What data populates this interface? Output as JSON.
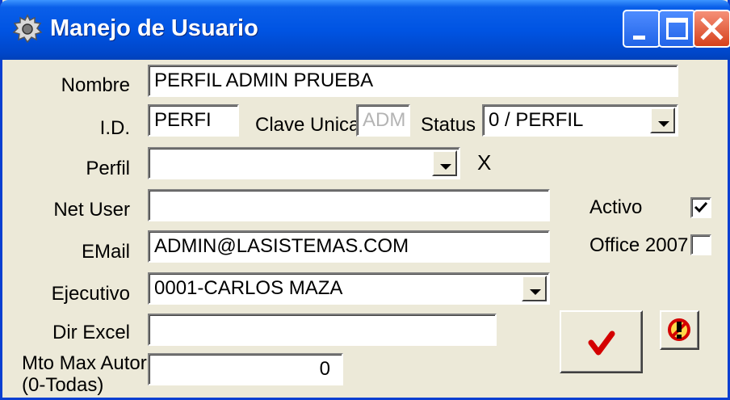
{
  "window": {
    "title": "Manejo de Usuario",
    "icons": [
      "gear-icon",
      "minimize-icon",
      "maximize-icon",
      "close-icon"
    ]
  },
  "form": {
    "nombre": {
      "label": "Nombre",
      "value": "PERFIL ADMIN PRUEBA"
    },
    "id": {
      "label": "I.D.",
      "value": "PERFI"
    },
    "clave_unica": {
      "label": "Clave Unica",
      "value": "ADM"
    },
    "status": {
      "label": "Status",
      "value": "0 / PERFIL"
    },
    "perfil": {
      "label": "Perfil",
      "value": "",
      "clear_label": "X"
    },
    "net_user": {
      "label": "Net User",
      "value": ""
    },
    "email": {
      "label": "EMail",
      "value": "ADMIN@LASISTEMAS.COM"
    },
    "ejecutivo": {
      "label": "Ejecutivo",
      "value": "0001-CARLOS MAZA"
    },
    "dir_excel": {
      "label": "Dir Excel",
      "value": ""
    },
    "mto_max_autor": {
      "label_line1": "Mto Max Autor",
      "label_line2": "(0-Todas)",
      "value": "0"
    },
    "activo": {
      "label": "Activo",
      "checked": true
    },
    "office_2007": {
      "label": "Office 2007",
      "checked": false
    }
  },
  "actions": {
    "accept_icon": "checkmark-icon",
    "cancel_icon": "cancel-icon"
  },
  "colors": {
    "titlebar": "#0054e3",
    "face": "#ece9d8",
    "accept": "#d40000",
    "close": "#d6411c"
  }
}
